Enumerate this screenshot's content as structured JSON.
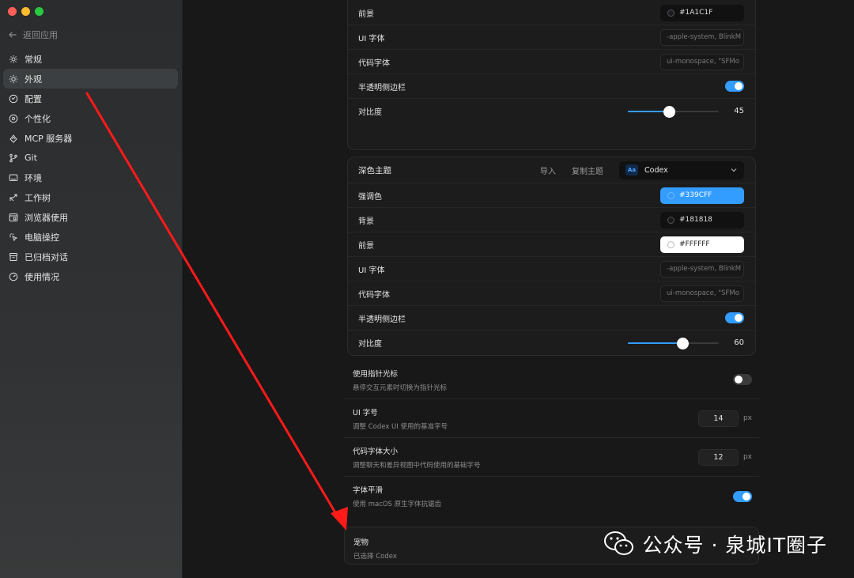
{
  "sidebar": {
    "back_label": "返回应用",
    "items": [
      {
        "label": "常规",
        "icon": "gear-icon",
        "active": false
      },
      {
        "label": "外观",
        "icon": "sun-icon",
        "active": true
      },
      {
        "label": "配置",
        "icon": "config-icon",
        "active": false
      },
      {
        "label": "个性化",
        "icon": "personalize-icon",
        "active": false
      },
      {
        "label": "MCP 服务器",
        "icon": "mcp-icon",
        "active": false
      },
      {
        "label": "Git",
        "icon": "git-branch-icon",
        "active": false
      },
      {
        "label": "环境",
        "icon": "monitor-icon",
        "active": false
      },
      {
        "label": "工作树",
        "icon": "worktree-icon",
        "active": false
      },
      {
        "label": "浏览器使用",
        "icon": "browser-icon",
        "active": false
      },
      {
        "label": "电脑操控",
        "icon": "cursor-icon",
        "active": false
      },
      {
        "label": "已归档对话",
        "icon": "archive-icon",
        "active": false
      },
      {
        "label": "使用情况",
        "icon": "gauge-icon",
        "active": false
      }
    ]
  },
  "light_theme": {
    "foreground": {
      "label": "前景",
      "value": "#1A1C1F"
    },
    "ui_font": {
      "label": "UI 字体",
      "placeholder": "-apple-system, BlinkM"
    },
    "code_font": {
      "label": "代码字体",
      "placeholder": "ui-monospace, \"SFMo"
    },
    "translucent_sidebar": {
      "label": "半透明侧边栏",
      "on": true
    },
    "contrast": {
      "label": "对比度",
      "value": 45
    }
  },
  "dark_theme": {
    "title": "深色主题",
    "import_label": "导入",
    "copy_label": "复制主题",
    "theme_name": "Codex",
    "theme_badge": "Aa",
    "accent": {
      "label": "强调色",
      "value": "#339CFF"
    },
    "background": {
      "label": "背景",
      "value": "#181818"
    },
    "foreground": {
      "label": "前景",
      "value": "#FFFFFF"
    },
    "ui_font": {
      "label": "UI 字体",
      "placeholder": "-apple-system, BlinkM"
    },
    "code_font": {
      "label": "代码字体",
      "placeholder": "ui-monospace, \"SFMo"
    },
    "translucent_sidebar": {
      "label": "半透明侧边栏",
      "on": true
    },
    "contrast": {
      "label": "对比度",
      "value": 60
    }
  },
  "settings": {
    "pointer_cursor": {
      "title": "使用指针光标",
      "desc": "悬停交互元素时切换为指针光标",
      "on": false
    },
    "ui_font_size": {
      "title": "UI 字号",
      "desc": "调整 Codex UI 使用的基准字号",
      "value": "14",
      "unit": "px"
    },
    "code_font_size": {
      "title": "代码字体大小",
      "desc": "调整聊天和差异视图中代码使用的基础字号",
      "value": "12",
      "unit": "px"
    },
    "font_smoothing": {
      "title": "字体平滑",
      "desc": "使用 macOS 原生字体抗锯齿",
      "on": true
    },
    "pet": {
      "title": "宠物",
      "desc": "已选择 Codex"
    }
  },
  "watermark": {
    "text": "公众号 · 泉城IT圈子"
  },
  "colors": {
    "accent": "#339CFF",
    "arrow": "#FF1A1A"
  }
}
